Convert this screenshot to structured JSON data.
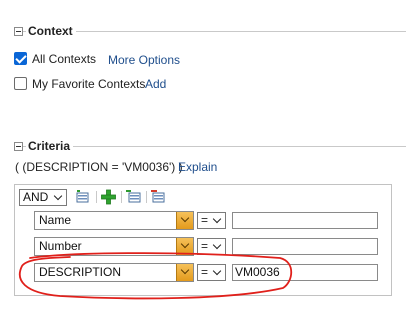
{
  "context": {
    "title": "Context",
    "options": [
      {
        "label": "All Contexts",
        "checked": true,
        "link": "More Options"
      },
      {
        "label": "My Favorite Contexts",
        "checked": false,
        "link": "Add"
      }
    ]
  },
  "criteria": {
    "title": "Criteria",
    "expression": "( (DESCRIPTION = 'VM0036') )",
    "explain_link": "Explain",
    "logic_operator": "AND",
    "toolbar_icons": [
      "add-condition-icon",
      "add-plus-icon",
      "add-group-icon",
      "delete-condition-icon"
    ],
    "rows": [
      {
        "field": "Name",
        "operator": "=",
        "value": ""
      },
      {
        "field": "Number",
        "operator": "=",
        "value": ""
      },
      {
        "field": "DESCRIPTION",
        "operator": "=",
        "value": "VM0036"
      }
    ],
    "highlight_color": "#e0201b"
  }
}
